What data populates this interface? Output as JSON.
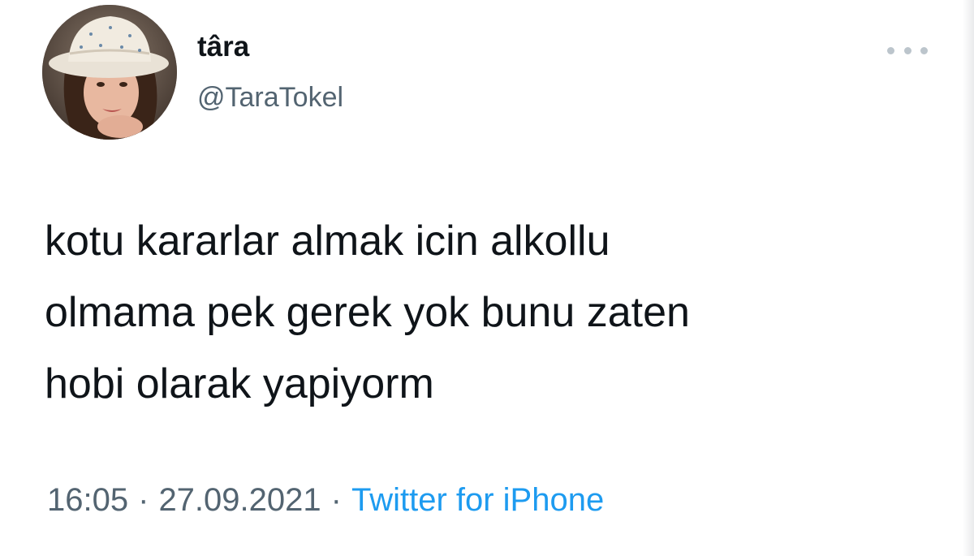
{
  "tweet": {
    "author": {
      "display_name": "târa",
      "handle": "@TaraTokel",
      "avatar": "profile-photo"
    },
    "more_icon": "more-horizontal-icon",
    "text_lines": [
      "kotu kararlar almak icin alkollu",
      "olmama pek gerek yok bunu zaten",
      "hobi olarak yapiyorm"
    ],
    "meta": {
      "time": "16:05",
      "separator": "·",
      "date": "27.09.2021",
      "source": "Twitter for iPhone"
    }
  },
  "colors": {
    "text": "#0f1419",
    "secondary": "#536471",
    "link": "#1d9bf0",
    "background": "#ffffff"
  }
}
